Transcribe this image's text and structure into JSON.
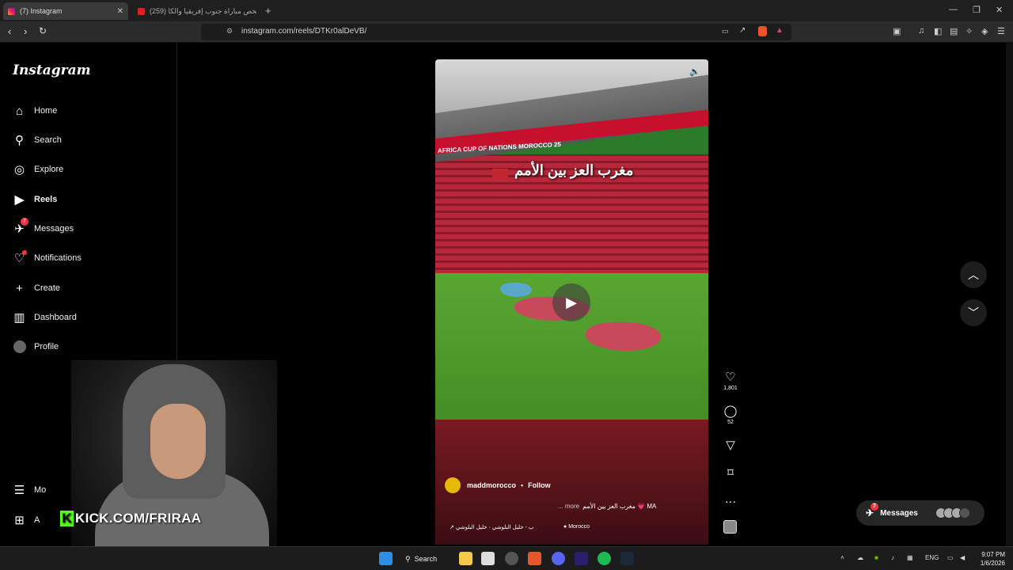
{
  "browser": {
    "tabs": [
      {
        "title": "(7) Instagram",
        "favicon": "instagram-icon",
        "active": true
      },
      {
        "title": "(259) ملخص مباراة جنوب إفريقيا والكا...",
        "favicon": "youtube-icon",
        "active": false
      }
    ],
    "url": "instagram.com/reels/DTKr0alDeVB/"
  },
  "sidebar": {
    "logo": "Instagram",
    "items": [
      {
        "label": "Home",
        "icon": "home-icon"
      },
      {
        "label": "Search",
        "icon": "search-icon"
      },
      {
        "label": "Explore",
        "icon": "compass-icon"
      },
      {
        "label": "Reels",
        "icon": "reels-icon"
      },
      {
        "label": "Messages",
        "icon": "messenger-icon",
        "badge": "7"
      },
      {
        "label": "Notifications",
        "icon": "heart-icon"
      },
      {
        "label": "Create",
        "icon": "plus-icon"
      },
      {
        "label": "Dashboard",
        "icon": "dashboard-icon"
      },
      {
        "label": "Profile",
        "icon": "avatar"
      }
    ],
    "more_label": "Mo",
    "also_label": "A"
  },
  "stream": {
    "overlay_text": "KICK.COM/FRIRAA",
    "logo_letter": "K"
  },
  "reel": {
    "caption_overlay": "مغرب العز بين الأمم",
    "banner_text": "AFRICA CUP OF NATIONS MOROCCO 25",
    "username": "maddmorocco",
    "follow": "Follow",
    "description": "مغرب العز بين الأمم 💗 MA",
    "more": "... more",
    "audio": "↗ ب - خليل البلوشي · خليل البلوشي",
    "location": "Morocco"
  },
  "actions": {
    "likes": "1,801",
    "comments": "52"
  },
  "messages_pill": {
    "label": "Messages",
    "badge": "7"
  },
  "taskbar": {
    "search": "Search",
    "lang": "ENG",
    "time": "9:07 PM",
    "date": "1/6/2026"
  },
  "colors": {
    "badge": "#ff3040",
    "kick": "#53fc18",
    "banner": "#c8102e"
  }
}
